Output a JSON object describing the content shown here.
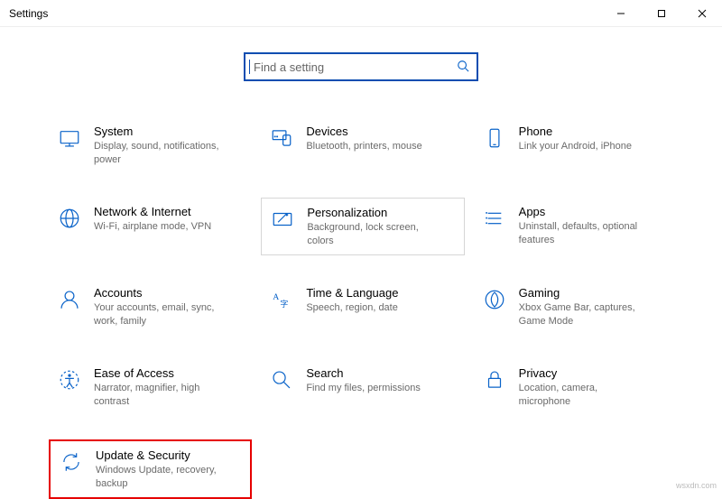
{
  "window": {
    "title": "Settings"
  },
  "search": {
    "placeholder": "Find a setting"
  },
  "tiles": {
    "system": {
      "label": "System",
      "desc": "Display, sound, notifications, power"
    },
    "devices": {
      "label": "Devices",
      "desc": "Bluetooth, printers, mouse"
    },
    "phone": {
      "label": "Phone",
      "desc": "Link your Android, iPhone"
    },
    "network": {
      "label": "Network & Internet",
      "desc": "Wi-Fi, airplane mode, VPN"
    },
    "personalization": {
      "label": "Personalization",
      "desc": "Background, lock screen, colors"
    },
    "apps": {
      "label": "Apps",
      "desc": "Uninstall, defaults, optional features"
    },
    "accounts": {
      "label": "Accounts",
      "desc": "Your accounts, email, sync, work, family"
    },
    "time": {
      "label": "Time & Language",
      "desc": "Speech, region, date"
    },
    "gaming": {
      "label": "Gaming",
      "desc": "Xbox Game Bar, captures, Game Mode"
    },
    "ease": {
      "label": "Ease of Access",
      "desc": "Narrator, magnifier, high contrast"
    },
    "search_tile": {
      "label": "Search",
      "desc": "Find my files, permissions"
    },
    "privacy": {
      "label": "Privacy",
      "desc": "Location, camera, microphone"
    },
    "update": {
      "label": "Update & Security",
      "desc": "Windows Update, recovery, backup"
    }
  },
  "watermark": "wsxdn.com"
}
